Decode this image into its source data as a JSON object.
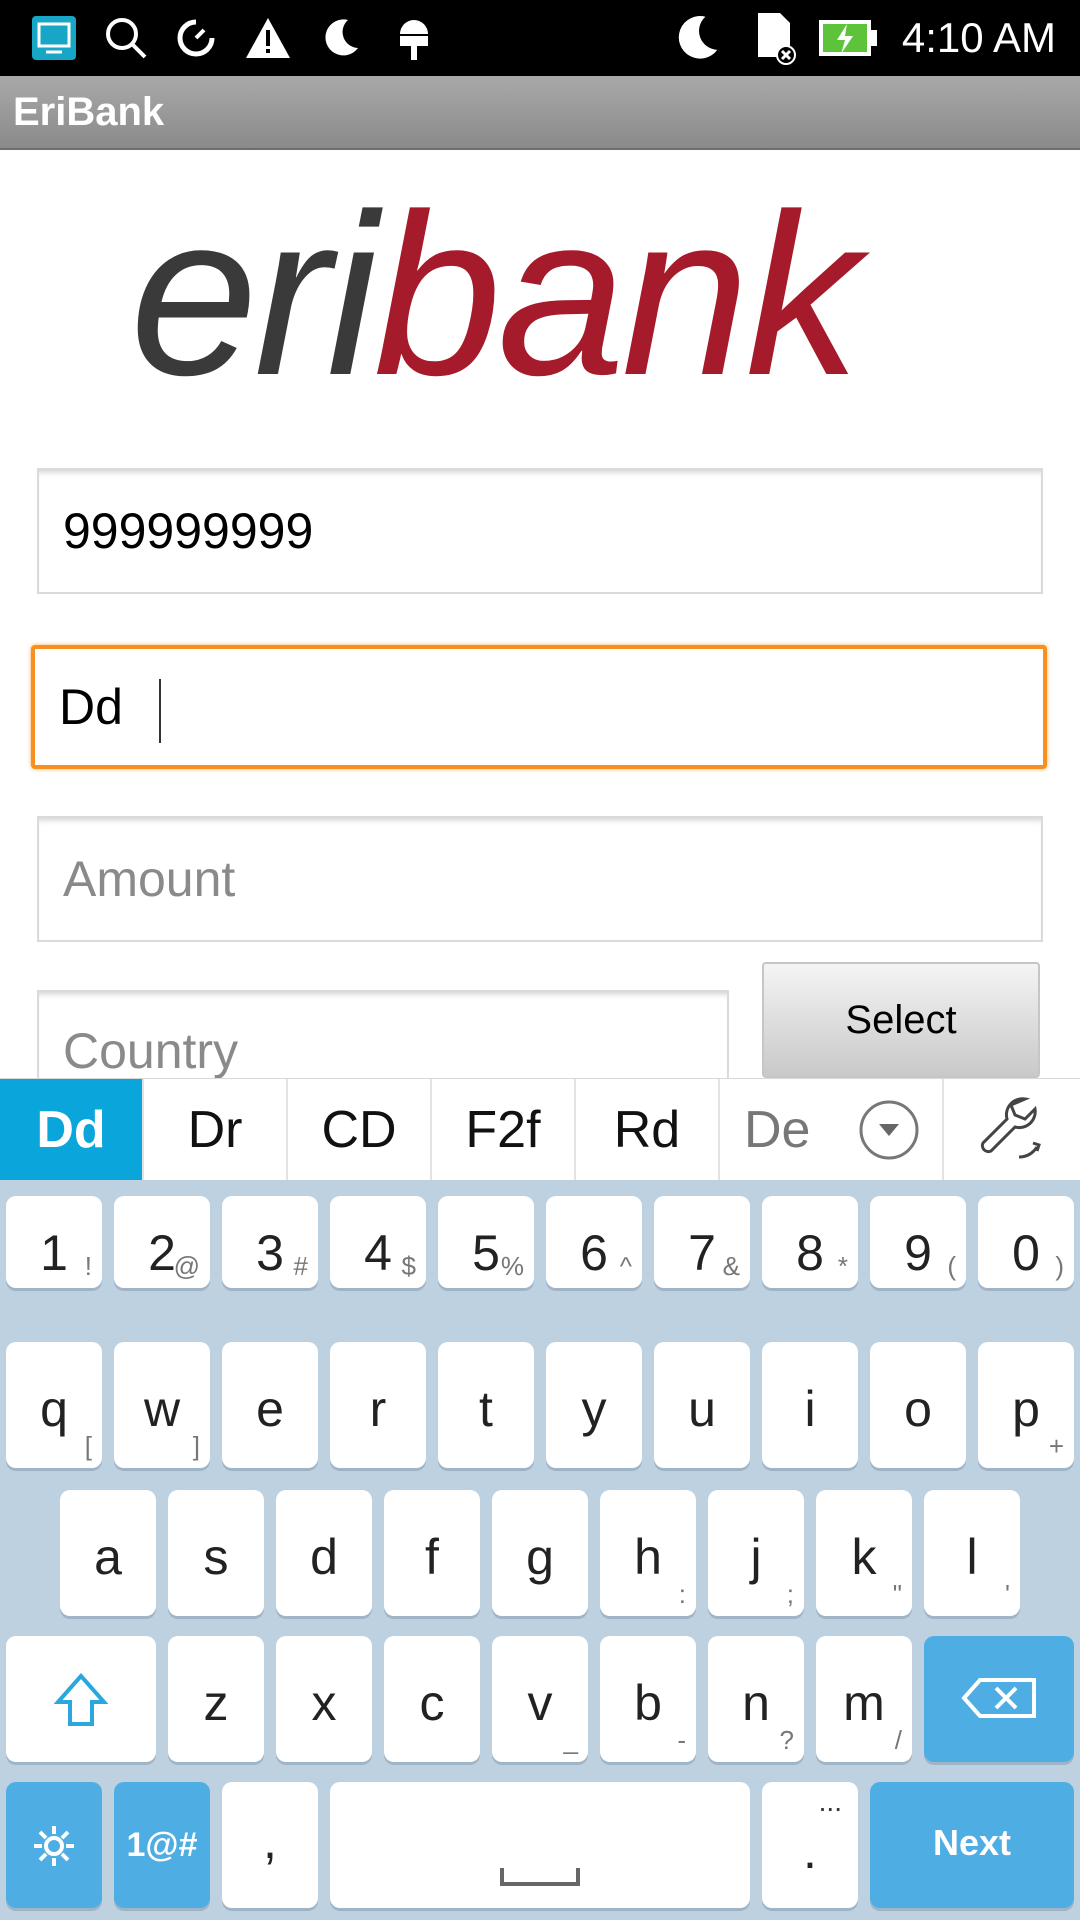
{
  "status_bar": {
    "time": "4:10 AM",
    "left_icons": [
      "screen-cast-icon",
      "search-icon",
      "data-saver-icon",
      "warning-icon",
      "moon-icon",
      "android-debug-icon"
    ],
    "right_icons": [
      "moon-icon",
      "sd-card-removed-icon",
      "battery-charging-icon"
    ]
  },
  "app": {
    "title": "EriBank"
  },
  "logo": {
    "part1": "eri",
    "part2": "bank"
  },
  "form": {
    "phone": {
      "value": "999999999"
    },
    "name": {
      "value": "Dd"
    },
    "amount": {
      "placeholder": "Amount"
    },
    "country": {
      "placeholder": "Country"
    },
    "select_label": "Select"
  },
  "suggestions": [
    "Dd",
    "Dr",
    "CD",
    "F2f",
    "Rd",
    "De"
  ],
  "keyboard": {
    "row1": [
      {
        "k": "1",
        "a": "!"
      },
      {
        "k": "2",
        "a": "@"
      },
      {
        "k": "3",
        "a": "#"
      },
      {
        "k": "4",
        "a": "$"
      },
      {
        "k": "5",
        "a": "%"
      },
      {
        "k": "6",
        "a": "^"
      },
      {
        "k": "7",
        "a": "&"
      },
      {
        "k": "8",
        "a": "*"
      },
      {
        "k": "9",
        "a": "("
      },
      {
        "k": "0",
        "a": ")"
      }
    ],
    "row2": [
      {
        "k": "q",
        "a": "["
      },
      {
        "k": "w",
        "a": "]"
      },
      {
        "k": "e",
        "a": ""
      },
      {
        "k": "r",
        "a": ""
      },
      {
        "k": "t",
        "a": ""
      },
      {
        "k": "y",
        "a": ""
      },
      {
        "k": "u",
        "a": ""
      },
      {
        "k": "i",
        "a": ""
      },
      {
        "k": "o",
        "a": ""
      },
      {
        "k": "p",
        "a": "+"
      }
    ],
    "row3": [
      {
        "k": "a",
        "a": ""
      },
      {
        "k": "s",
        "a": ""
      },
      {
        "k": "d",
        "a": ""
      },
      {
        "k": "f",
        "a": ""
      },
      {
        "k": "g",
        "a": ""
      },
      {
        "k": "h",
        "a": ":"
      },
      {
        "k": "j",
        "a": ";"
      },
      {
        "k": "k",
        "a": "\""
      },
      {
        "k": "l",
        "a": "'"
      }
    ],
    "row4": [
      {
        "k": "z",
        "a": ""
      },
      {
        "k": "x",
        "a": ""
      },
      {
        "k": "c",
        "a": ""
      },
      {
        "k": "v",
        "a": "_"
      },
      {
        "k": "b",
        "a": "-"
      },
      {
        "k": "n",
        "a": "?"
      },
      {
        "k": "m",
        "a": "/"
      }
    ],
    "symbols_label": "1@#",
    "comma": ",",
    "period": ".",
    "period_alt": "...",
    "next_label": "Next"
  },
  "colors": {
    "focus_border": "#f7901e",
    "suggestion_active": "#0aa5da",
    "key_blue": "#4eaee3",
    "keyboard_bg": "#bdd1e1",
    "logo_red": "#a61b2b"
  }
}
